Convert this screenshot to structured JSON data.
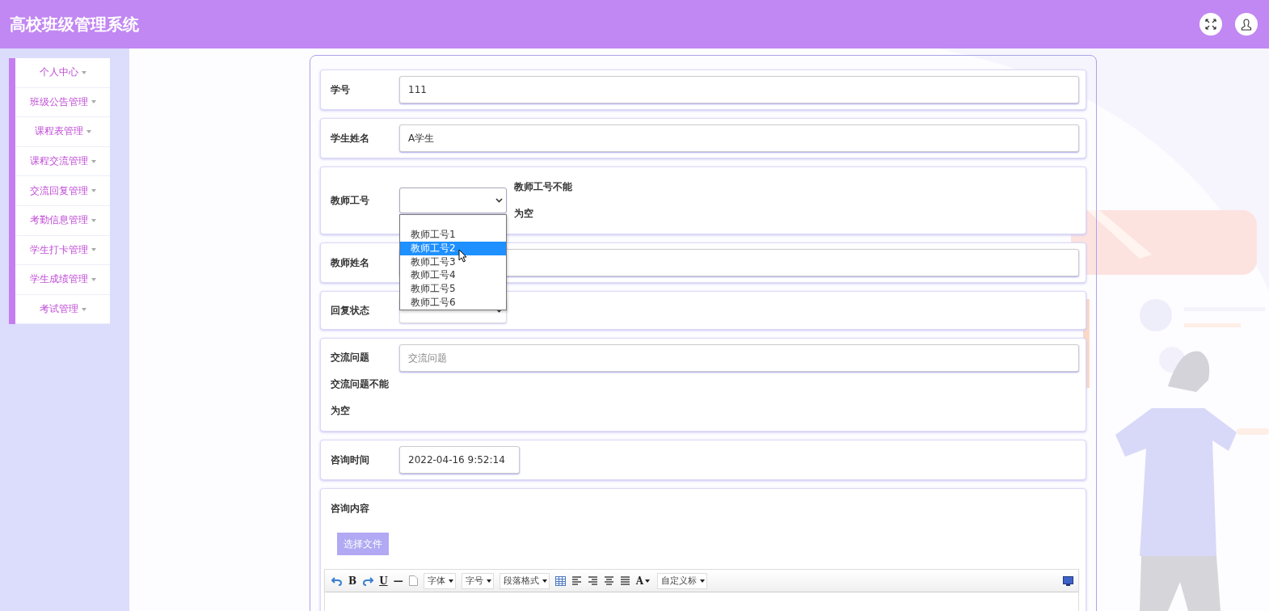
{
  "header": {
    "title": "高校班级管理系统"
  },
  "sidebar": {
    "items": [
      {
        "label": "个人中心"
      },
      {
        "label": "班级公告管理"
      },
      {
        "label": "课程表管理"
      },
      {
        "label": "课程交流管理"
      },
      {
        "label": "交流回复管理"
      },
      {
        "label": "考勤信息管理"
      },
      {
        "label": "学生打卡管理"
      },
      {
        "label": "学生成绩管理"
      },
      {
        "label": "考试管理"
      }
    ]
  },
  "form": {
    "fields": [
      {
        "kind": "text",
        "label": "学号",
        "value": "111"
      },
      {
        "kind": "text",
        "label": "学生姓名",
        "value": "A学生"
      },
      {
        "kind": "select",
        "label": "教师工号",
        "error": "教师工号不能为空",
        "open": true,
        "options": [
          {
            "label": "教师工号1",
            "selected": false
          },
          {
            "label": "教师工号2",
            "selected": true
          },
          {
            "label": "教师工号3",
            "selected": false
          },
          {
            "label": "教师工号4",
            "selected": false
          },
          {
            "label": "教师工号5",
            "selected": false
          },
          {
            "label": "教师工号6",
            "selected": false
          }
        ]
      },
      {
        "kind": "text",
        "label": "教师姓名"
      },
      {
        "kind": "select",
        "label": "回复状态"
      },
      {
        "kind": "text",
        "label": "交流问题",
        "placeholder": "交流问题",
        "error": "交流问题不能为空"
      },
      {
        "kind": "short",
        "label": "咨询时间",
        "value": "2022-04-16 9:52:14"
      },
      {
        "kind": "editor",
        "label": "咨询内容",
        "upload_button": "选择文件",
        "toolbar": {
          "bold": "B",
          "underline": "U",
          "rule": "—",
          "font_color": "A",
          "selects": [
            "字体",
            "字号",
            "段落格式",
            "自定义标"
          ]
        }
      }
    ]
  }
}
